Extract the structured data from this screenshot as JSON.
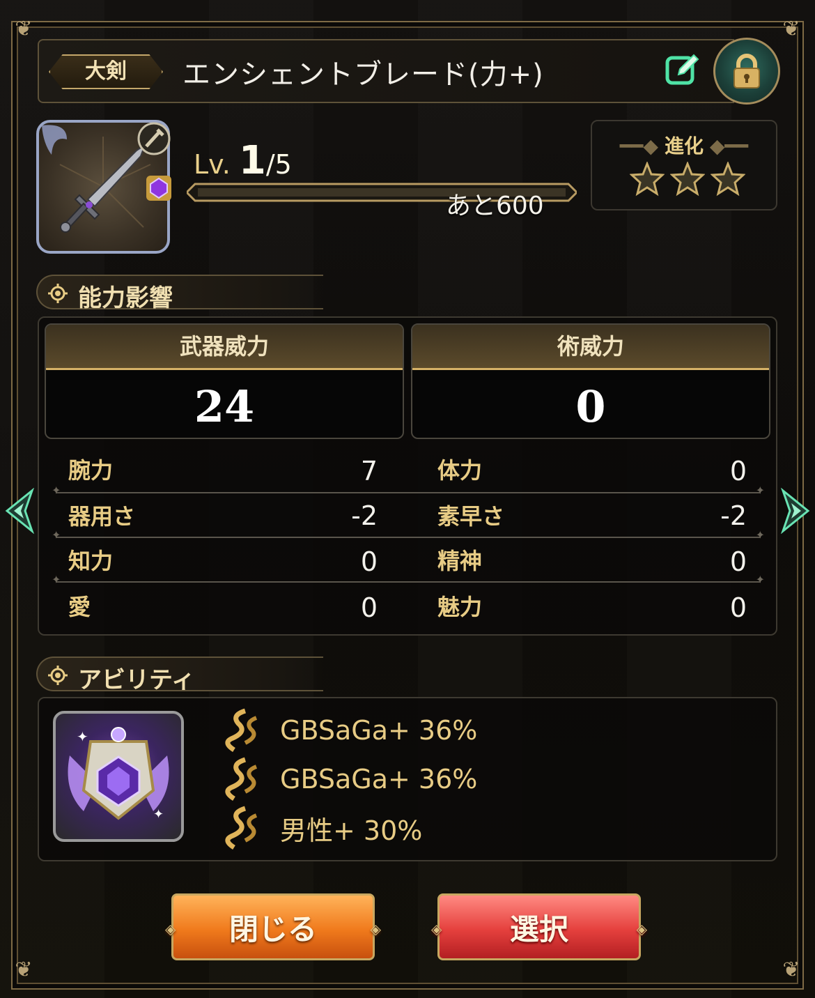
{
  "header": {
    "weapon_type": "大剣",
    "weapon_name": "エンシェントブレード(力+)",
    "edit_icon": "edit-icon",
    "lock_icon": "lock-icon"
  },
  "level": {
    "prefix": "Lv.",
    "current": "1",
    "max": "/5",
    "remaining": "あと600",
    "progress": 0
  },
  "evolution": {
    "label": "進化",
    "stars_total": 3,
    "stars_filled": 0
  },
  "sections": {
    "ability_influence": "能力影響",
    "abilities": "アビリティ"
  },
  "power": {
    "weapon": {
      "label": "武器威力",
      "value": "24"
    },
    "magic": {
      "label": "術威力",
      "value": "0"
    }
  },
  "stats": {
    "left": [
      {
        "label": "腕力",
        "value": "7"
      },
      {
        "label": "器用さ",
        "value": "-2"
      },
      {
        "label": "知力",
        "value": "0"
      },
      {
        "label": "愛",
        "value": "0"
      }
    ],
    "right": [
      {
        "label": "体力",
        "value": "0"
      },
      {
        "label": "素早さ",
        "value": "-2"
      },
      {
        "label": "精神",
        "value": "0"
      },
      {
        "label": "魅力",
        "value": "0"
      }
    ]
  },
  "abilities": [
    {
      "text": "GBSaGa+ 36%"
    },
    {
      "text": "GBSaGa+ 36%"
    },
    {
      "text": "男性+ 30%"
    }
  ],
  "buttons": {
    "close": "閉じる",
    "select": "選択"
  },
  "colors": {
    "gold_text": "#e8cc85",
    "close_button": "#f07a1c",
    "select_button": "#e5403d",
    "lock_button": "#2f6b5e"
  }
}
